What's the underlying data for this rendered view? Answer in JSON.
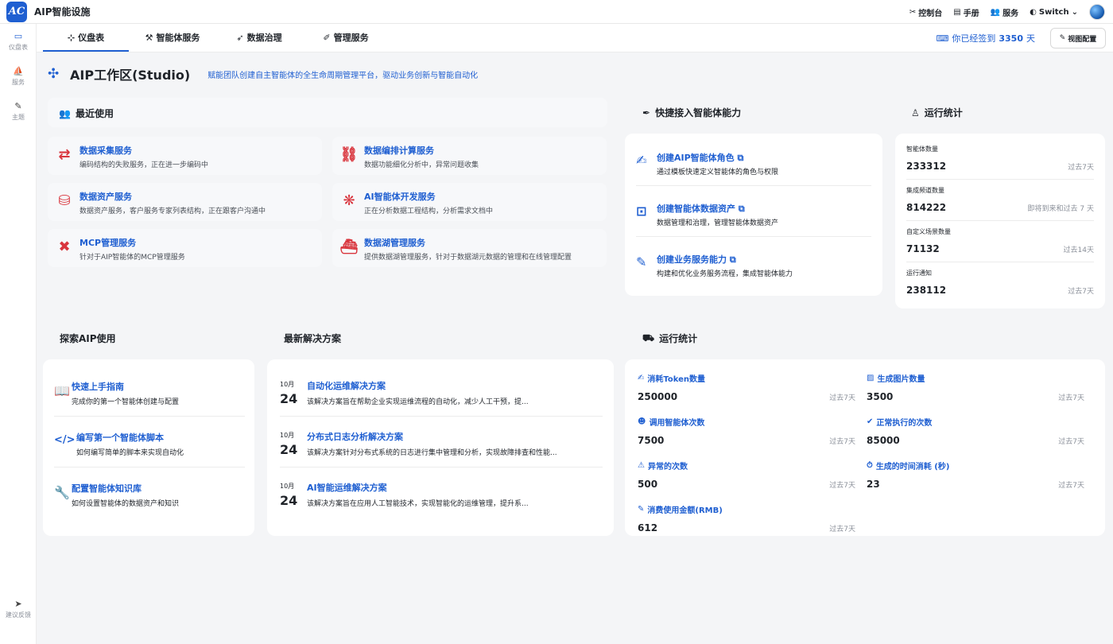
{
  "app": {
    "logo_text": "AC",
    "title": "AIP智能设施"
  },
  "top_actions": [
    {
      "icon": "✂",
      "label": "控制台"
    },
    {
      "icon": "▤",
      "label": "手册"
    },
    {
      "icon": "👥",
      "label": "服务"
    },
    {
      "icon": "◐",
      "label": "Switch",
      "caret": "⌄"
    }
  ],
  "sidebar": {
    "items": [
      {
        "icon": "▭",
        "label": "仪盘表"
      },
      {
        "icon": "⛵",
        "label": "服务"
      },
      {
        "icon": "✎",
        "label": "主题"
      }
    ],
    "feedback": {
      "icon": "➤",
      "label": "建议反馈"
    }
  },
  "tabs": [
    {
      "icon": "⊹",
      "label": "仪盘表"
    },
    {
      "icon": "⚒",
      "label": "智能体服务"
    },
    {
      "icon": "➶",
      "label": "数据治理"
    },
    {
      "icon": "✐",
      "label": "管理服务"
    }
  ],
  "checkin": {
    "icon": "⌨",
    "prefix": "你已经签到",
    "days": "3350",
    "suffix": "天"
  },
  "view_config": {
    "icon": "✎",
    "label": "视图配置"
  },
  "workspace": {
    "icon": "✣",
    "title": "AIP工作区(Studio)",
    "subtitle": "赋能团队创建自主智能体的全生命周期管理平台，驱动业务创新与智能自动化"
  },
  "recent": {
    "icon": "👥",
    "title": "最近使用",
    "items": [
      {
        "icon": "⇄",
        "title": "数据采集服务",
        "desc": "编码结构的失败服务，正在进一步编码中"
      },
      {
        "icon": "⛓",
        "title": "数据编排计算服务",
        "desc": "数据功能细化分析中，异常问题收集"
      },
      {
        "icon": "⛁",
        "title": "数据资产服务",
        "desc": "数据资产服务，客户服务专家列表结构，正在跟客户沟通中"
      },
      {
        "icon": "❋",
        "title": "AI智能体开发服务",
        "desc": "正在分析数据工程结构，分析需求文档中"
      },
      {
        "icon": "✖",
        "title": "MCP管理服务",
        "desc": "针对于AIP智能体的MCP管理服务"
      },
      {
        "icon": "⛴",
        "title": "数据湖管理服务",
        "desc": "提供数据湖管理服务，针对于数据湖元数据的管理和在线管理配置"
      }
    ]
  },
  "quick_access": {
    "icon": "✒",
    "title": "快捷接入智能体能力",
    "link_icon": "⧉",
    "items": [
      {
        "icon": "✍",
        "title": "创建AIP智能体角色",
        "desc": "通过模板快速定义智能体的角色与权限"
      },
      {
        "icon": "⊡",
        "title": "创建智能体数据资产",
        "desc": "数据管理和治理，管理智能体数据资产"
      },
      {
        "icon": "✎",
        "title": "创建业务服务能力",
        "desc": "构建和优化业务服务流程，集成智能体能力"
      }
    ]
  },
  "run_stats_top": {
    "icon": "♙",
    "title": "运行统计",
    "items": [
      {
        "label": "智能体数量",
        "value": "233312",
        "period": "过去7天"
      },
      {
        "label": "集成频道数量",
        "value": "814222",
        "period": "即将到来和过去 7 天"
      },
      {
        "label": "自定义场景数量",
        "value": "71132",
        "period": "过去14天"
      },
      {
        "label": "运行通知",
        "value": "238112",
        "period": "过去7天"
      }
    ]
  },
  "explore": {
    "title": "探索AIP使用",
    "items": [
      {
        "icon": "📖",
        "title": "快速上手指南",
        "desc": "完成你的第一个智能体创建与配置"
      },
      {
        "icon": "</>",
        "title": "编写第一个智能体脚本",
        "desc": "如何编写简单的脚本来实现自动化"
      },
      {
        "icon": "🔧",
        "title": "配置智能体知识库",
        "desc": "如何设置智能体的数据资产和知识"
      }
    ]
  },
  "solutions": {
    "title": "最新解决方案",
    "items": [
      {
        "month": "10月",
        "day": "24",
        "title": "自动化运维解决方案",
        "desc": "该解决方案旨在帮助企业实现运维流程的自动化，减少人工干预，提..."
      },
      {
        "month": "10月",
        "day": "24",
        "title": "分布式日志分析解决方案",
        "desc": "该解决方案针对分布式系统的日志进行集中管理和分析，实现故障排查和性能..."
      },
      {
        "month": "10月",
        "day": "24",
        "title": "AI智能运维解决方案",
        "desc": "该解决方案旨在应用人工智能技术，实现智能化的运维管理，提升系..."
      }
    ]
  },
  "run_stats_bottom": {
    "icon": "⛟",
    "title": "运行统计",
    "items": [
      {
        "icon": "✍",
        "label": "消耗Token数量",
        "value": "250000",
        "period": "过去7天"
      },
      {
        "icon": "▨",
        "label": "生成图片数量",
        "value": "3500",
        "period": "过去7天"
      },
      {
        "icon": "☻",
        "label": "调用智能体次数",
        "value": "7500",
        "period": "过去7天"
      },
      {
        "icon": "✔",
        "label": "正常执行的次数",
        "value": "85000",
        "period": "过去7天"
      },
      {
        "icon": "⚠",
        "label": "异常的次数",
        "value": "500",
        "period": "过去7天"
      },
      {
        "icon": "⏱",
        "label": "生成的时间消耗 (秒)",
        "value": "23",
        "period": "过去7天"
      },
      {
        "icon": "✎",
        "label": "消费使用金额(RMB)",
        "value": "612",
        "period": "过去7天"
      }
    ]
  }
}
